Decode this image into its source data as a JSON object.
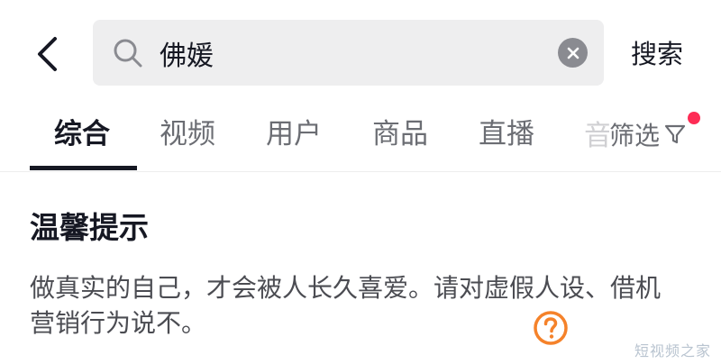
{
  "search": {
    "value": "佛媛",
    "submit_label": "搜索"
  },
  "tabs": [
    {
      "label": "综合",
      "active": true
    },
    {
      "label": "视频",
      "active": false
    },
    {
      "label": "用户",
      "active": false
    },
    {
      "label": "商品",
      "active": false
    },
    {
      "label": "直播",
      "active": false
    },
    {
      "label": "音",
      "active": false
    }
  ],
  "filter": {
    "label": "筛选",
    "has_notification_dot": true
  },
  "tip": {
    "title": "温馨提示",
    "line1": "做真实的自己，才会被人长久喜爱。请对虚假人设、借机",
    "line2": "营销行为说不。"
  },
  "watermark": "短视频之家",
  "icons": {
    "back": "chevron-left-icon",
    "search": "search-icon",
    "clear": "clear-icon",
    "filter": "filter-funnel-icon",
    "help": "help-question-icon"
  },
  "colors": {
    "notification_dot": "#fe2c55",
    "help_icon": "#f5822a",
    "text_primary": "#161823",
    "text_secondary": "#6b6d73",
    "search_bg": "#eeeeef"
  }
}
